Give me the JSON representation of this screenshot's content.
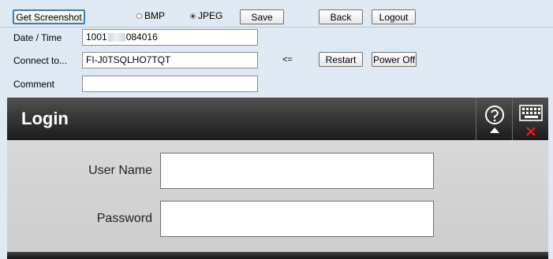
{
  "toolbar": {
    "get_screenshot": "Get Screenshot",
    "format_bmp": "BMP",
    "format_jpeg": "JPEG",
    "selected_format": "JPEG",
    "save": "Save",
    "back": "Back",
    "logout": "Logout"
  },
  "info": {
    "datetime_label": "Date / Time",
    "datetime_value_prefix": "1001",
    "datetime_value_suffix": "084016",
    "connect_label": "Connect to...",
    "connect_value": "FI-J0TSQLHO7TQT",
    "arrow": "<=",
    "restart": "Restart",
    "power_off": "Power Off",
    "comment_label": "Comment",
    "comment_value": ""
  },
  "login_panel": {
    "title": "Login",
    "username_label": "User Name",
    "password_label": "Password",
    "username_value": "",
    "password_value": ""
  },
  "icons": [
    "help-icon",
    "keyboard-icon",
    "close-icon"
  ]
}
